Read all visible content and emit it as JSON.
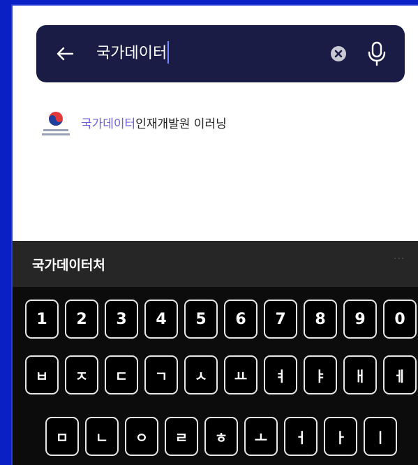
{
  "search": {
    "query": "국가데이터"
  },
  "suggestion": {
    "highlight": "국가데이터",
    "rest": "인재개발원 이러닝"
  },
  "keyboard": {
    "suggestion_word": "국가데이터처",
    "more": "···",
    "row_numbers": [
      "1",
      "2",
      "3",
      "4",
      "5",
      "6",
      "7",
      "8",
      "9",
      "0"
    ],
    "row1": [
      "ㅂ",
      "ㅈ",
      "ㄷ",
      "ㄱ",
      "ㅅ",
      "ㅛ",
      "ㅕ",
      "ㅑ",
      "ㅐ",
      "ㅔ"
    ],
    "row2": [
      "ㅁ",
      "ㄴ",
      "ㅇ",
      "ㄹ",
      "ㅎ",
      "ㅗ",
      "ㅓ",
      "ㅏ",
      "ㅣ"
    ]
  },
  "colors": {
    "background": "#0a1fc4",
    "searchbar": "#1a1c45",
    "highlight": "#6c5fd6",
    "keyboard": "#0c0c0c"
  }
}
